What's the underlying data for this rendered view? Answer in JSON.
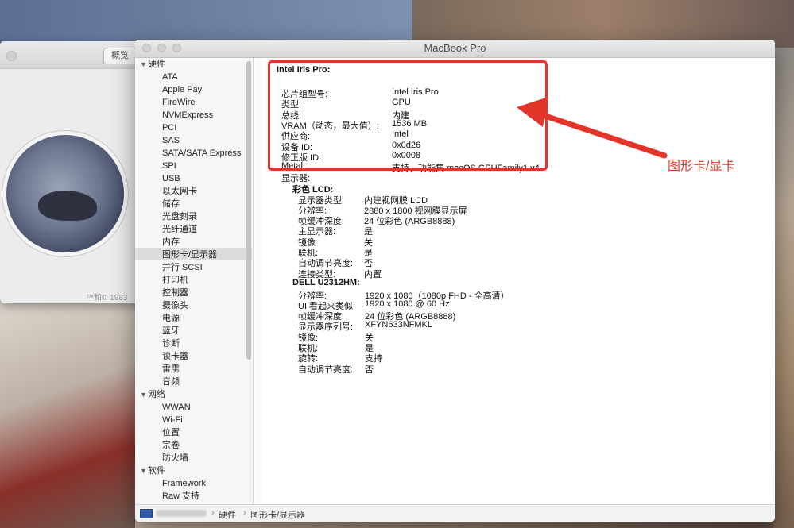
{
  "back_window": {
    "tab_label": "概览",
    "copyright": "™和© 1983"
  },
  "window": {
    "title": "MacBook Pro"
  },
  "sidebar": {
    "groups": [
      {
        "label": "硬件",
        "items": [
          "ATA",
          "Apple Pay",
          "FireWire",
          "NVMExpress",
          "PCI",
          "SAS",
          "SATA/SATA Express",
          "SPI",
          "USB",
          "以太网卡",
          "储存",
          "光盘刻录",
          "光纤通道",
          "内存",
          "图形卡/显示器",
          "并行 SCSI",
          "打印机",
          "控制器",
          "摄像头",
          "电源",
          "蓝牙",
          "诊断",
          "读卡器",
          "雷雳",
          "音频"
        ]
      },
      {
        "label": "网络",
        "items": [
          "WWAN",
          "Wi-Fi",
          "位置",
          "宗卷",
          "防火墙"
        ]
      },
      {
        "label": "软件",
        "items": [
          "Framework",
          "Raw 支持"
        ]
      }
    ],
    "selected": "图形卡/显示器"
  },
  "content": {
    "gpu_name": "Intel Iris Pro:",
    "gpu_props": [
      {
        "k": "芯片组型号:",
        "v": "Intel Iris Pro"
      },
      {
        "k": "类型:",
        "v": "GPU"
      },
      {
        "k": "总线:",
        "v": "内建"
      },
      {
        "k": "VRAM（动态，最大值）:",
        "v": "1536 MB"
      },
      {
        "k": "供应商:",
        "v": "Intel"
      },
      {
        "k": "设备 ID:",
        "v": "0x0d26"
      },
      {
        "k": "修正版 ID:",
        "v": "0x0008"
      },
      {
        "k": "Metal:",
        "v": "支持，功能集 macOS GPUFamily1 v4"
      }
    ],
    "displays_label": "显示器:",
    "display1": {
      "name": "彩色 LCD:",
      "props": [
        {
          "k": "显示器类型:",
          "v": "内建视网膜 LCD"
        },
        {
          "k": "分辨率:",
          "v": "2880 x 1800 视网膜显示屏"
        },
        {
          "k": "帧缓冲深度:",
          "v": "24 位彩色 (ARGB8888)"
        },
        {
          "k": "主显示器:",
          "v": "是"
        },
        {
          "k": "镜像:",
          "v": "关"
        },
        {
          "k": "联机:",
          "v": "是"
        },
        {
          "k": "自动调节亮度:",
          "v": "否"
        },
        {
          "k": "连接类型:",
          "v": "内置"
        }
      ]
    },
    "display2": {
      "name": "DELL U2312HM:",
      "props": [
        {
          "k": "分辨率:",
          "v": "1920 x 1080（1080p FHD - 全高清）"
        },
        {
          "k": "UI 看起来类似:",
          "v": "1920 x 1080 @ 60 Hz"
        },
        {
          "k": "帧缓冲深度:",
          "v": "24 位彩色 (ARGB8888)"
        },
        {
          "k": "显示器序列号:",
          "v": "XFYN633NFMKL"
        },
        {
          "k": "镜像:",
          "v": "关"
        },
        {
          "k": "联机:",
          "v": "是"
        },
        {
          "k": "旋转:",
          "v": "支持"
        },
        {
          "k": "自动调节亮度:",
          "v": "否"
        }
      ]
    }
  },
  "pathbar": {
    "segments": [
      "硬件",
      "图形卡/显示器"
    ]
  },
  "annotation": {
    "label": "图形卡/显卡",
    "color": "#e2362a"
  }
}
